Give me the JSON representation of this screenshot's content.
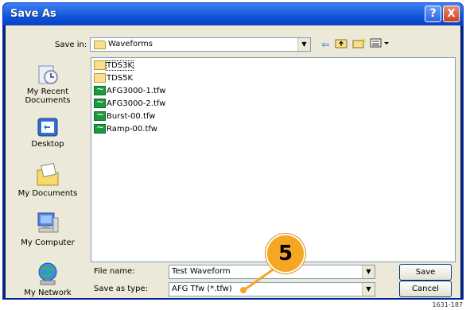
{
  "window": {
    "title": "Save As",
    "help_label": "?",
    "close_label": "X"
  },
  "toolbar": {
    "save_in_label": "Save in:",
    "save_in_value": "Waveforms",
    "back_icon": "back-arrow-icon",
    "up_icon": "up-folder-icon",
    "new_folder_icon": "new-folder-icon",
    "views_icon": "views-menu-icon"
  },
  "places": [
    {
      "label": "My Recent Documents",
      "icon": "recent-documents-icon"
    },
    {
      "label": "Desktop",
      "icon": "desktop-icon"
    },
    {
      "label": "My Documents",
      "icon": "my-documents-icon"
    },
    {
      "label": "My Computer",
      "icon": "my-computer-icon"
    },
    {
      "label": "My Network",
      "icon": "my-network-icon"
    }
  ],
  "files": [
    {
      "name": "TDS3K",
      "type": "folder"
    },
    {
      "name": "TDS5K",
      "type": "folder"
    },
    {
      "name": "AFG3000-1.tfw",
      "type": "waveform"
    },
    {
      "name": "AFG3000-2.tfw",
      "type": "waveform"
    },
    {
      "name": "Burst-00.tfw",
      "type": "waveform"
    },
    {
      "name": "Ramp-00.tfw",
      "type": "waveform"
    }
  ],
  "form": {
    "file_name_label": "File name:",
    "file_name_value": "Test Waveform",
    "save_as_type_label": "Save as type:",
    "save_as_type_value": "AFG Tfw (*.tfw)"
  },
  "buttons": {
    "save": "Save",
    "cancel": "Cancel"
  },
  "callout": {
    "number": "5",
    "color": "#f5a623"
  },
  "figure_number": "1631-187"
}
